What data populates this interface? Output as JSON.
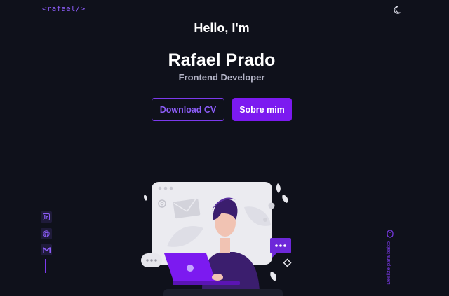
{
  "header": {
    "logo": "<rafael/>",
    "theme_icon": "moon-icon"
  },
  "hero": {
    "greeting": "Hello, I'm",
    "name": "Rafael Prado",
    "role": "Frontend Developer",
    "download_cv_label": "Download CV",
    "about_label": "Sobre mim"
  },
  "social": [
    {
      "icon": "linkedin-icon"
    },
    {
      "icon": "github-icon"
    },
    {
      "icon": "gmail-icon"
    }
  ],
  "scroll": {
    "label": "Deslize para baixo",
    "icon": "mouse-icon"
  },
  "colors": {
    "background": "#0f111b",
    "accent": "#7c3aed",
    "accent_fill": "#7c1af0",
    "text": "#ffffff",
    "muted": "#b3b4c6"
  }
}
